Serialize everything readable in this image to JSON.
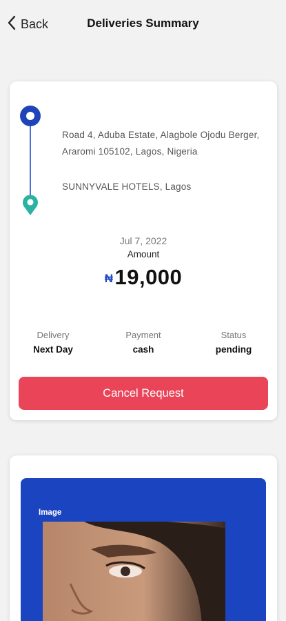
{
  "header": {
    "back_label": "Back",
    "title": "Deliveries Summary"
  },
  "route": {
    "pickup_address": "Road 4, Aduba Estate, Alagbole Ojodu Berger, Araromi 105102, Lagos, Nigeria",
    "dropoff_address": "SUNNYVALE HOTELS, Lagos"
  },
  "summary": {
    "date": "Jul 7, 2022",
    "amount_label": "Amount",
    "currency_symbol": "₦",
    "amount_value": "19,000"
  },
  "details": {
    "delivery_label": "Delivery",
    "delivery_value": "Next Day",
    "payment_label": "Payment",
    "payment_value": "cash",
    "status_label": "Status",
    "status_value": "pending"
  },
  "actions": {
    "cancel_label": "Cancel Request"
  },
  "image_card": {
    "label": "Image"
  },
  "colors": {
    "accent_blue": "#1f43b8",
    "dest_pin": "#2ab3a3",
    "cancel_red": "#ea4459",
    "panel_blue": "#1b44c0"
  },
  "icons": {
    "back": "chevron-left-icon",
    "origin": "origin-pin-icon",
    "destination": "destination-pin-icon"
  }
}
